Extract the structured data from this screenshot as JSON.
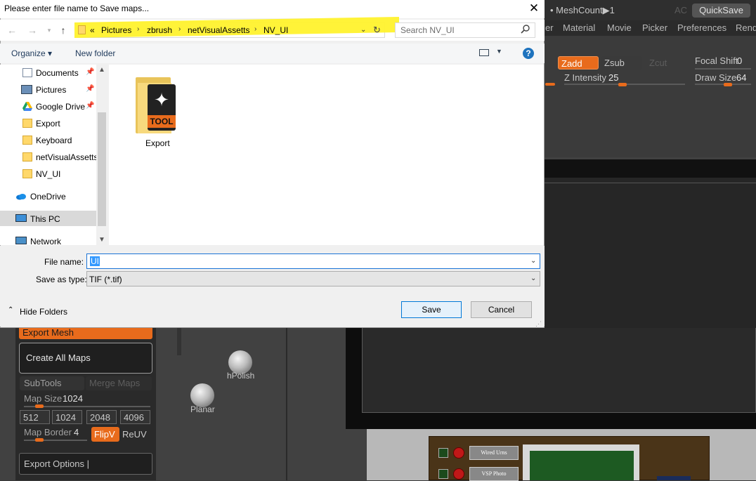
{
  "dialog": {
    "title": "Please enter file name to Save maps...",
    "address": {
      "overflow": "«",
      "crumbs": [
        "Pictures",
        "zbrush",
        "netVisualAssetts",
        "NV_UI"
      ]
    },
    "search_placeholder": "Search NV_UI",
    "toolbar": {
      "organize": "Organize ▾",
      "new_folder": "New folder",
      "help": "?"
    },
    "nav_items": [
      {
        "label": "Documents",
        "icon": "documents-icon",
        "pinned": true
      },
      {
        "label": "Pictures",
        "icon": "pictures-icon",
        "pinned": true
      },
      {
        "label": "Google Drive",
        "icon": "google-drive-icon",
        "pinned": true
      },
      {
        "label": "Export",
        "icon": "folder-icon",
        "pinned": false
      },
      {
        "label": "Keyboard",
        "icon": "folder-icon",
        "pinned": false
      },
      {
        "label": "netVisualAssetts",
        "icon": "folder-icon",
        "pinned": false
      },
      {
        "label": "NV_UI",
        "icon": "folder-icon",
        "pinned": false
      },
      {
        "label": "OneDrive",
        "icon": "onedrive-icon",
        "pinned": false
      },
      {
        "label": "This PC",
        "icon": "this-pc-icon",
        "pinned": false,
        "selected": true
      },
      {
        "label": "Network",
        "icon": "network-icon",
        "pinned": false
      }
    ],
    "files": [
      {
        "name": "Export",
        "icon": "tool-folder-icon",
        "badge": "TOOL"
      }
    ],
    "file_name_label": "File name:",
    "file_name_value": "UI",
    "save_type_label": "Save as type:",
    "save_type_value": "TIF (*.tif)",
    "hide_folders": "Hide Folders",
    "save": "Save",
    "cancel": "Cancel"
  },
  "zbrush": {
    "meshcount": "• MeshCount▶1",
    "ac": "AC",
    "quicksave": "QuickSave",
    "menus": [
      "er",
      "Material",
      "Movie",
      "Picker",
      "Preferences",
      "Rend"
    ],
    "zadd": "Zadd",
    "zsub": "Zsub",
    "zcut": "Zcut",
    "focal_shift_label": "Focal Shift",
    "focal_shift_value": "0",
    "z_intensity_label": "Z Intensity",
    "z_intensity_value": "25",
    "draw_size_label": "Draw Size",
    "draw_size_value": "64",
    "export_mesh": "Export Mesh",
    "create_all_maps": "Create All Maps",
    "subtools": "SubTools",
    "merge_maps": "Merge Maps",
    "map_size_label": "Map Size",
    "map_size_value": "1024",
    "map_sizes": [
      "512",
      "1024",
      "2048",
      "4096"
    ],
    "map_border_label": "Map Border",
    "map_border_value": "4",
    "flipv": "FlipV",
    "reuv": "ReUV",
    "export_options": "Export Options |",
    "hpolish": "hPolish",
    "planar": "Planar",
    "device_btn_1": "Wired Urns",
    "device_btn_2": "VSP Photo"
  },
  "colors": {
    "zbrush_accent": "#e86b1c",
    "highlight": "#fff22d",
    "windows_blue": "#0078d7"
  }
}
